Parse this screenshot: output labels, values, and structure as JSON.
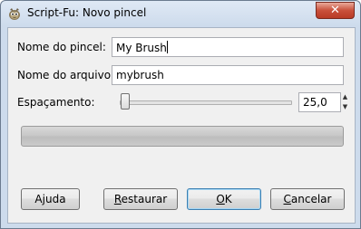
{
  "window": {
    "title": "Script-Fu: Novo pincel",
    "close_label": "✕"
  },
  "form": {
    "brush_name_label": "Nome do pincel:",
    "brush_name_value": "My Brush",
    "file_name_label": "Nome do arquivo:",
    "file_name_value": "mybrush",
    "spacing_label": "Espaçamento:",
    "spacing_value": "25,0",
    "spacing_slider_fraction": 0.0
  },
  "progress": {
    "fraction": 0.0
  },
  "buttons": {
    "help": {
      "first": "A",
      "mnemonic": "j",
      "rest": "uda"
    },
    "reset": {
      "mnemonic": "R",
      "rest": "estaurar"
    },
    "ok": {
      "mnemonic": "O",
      "rest": "K"
    },
    "cancel": {
      "mnemonic": "C",
      "rest": "ancelar"
    }
  },
  "icons": {
    "app": "gimp-icon",
    "close": "close-icon",
    "spin_up": "chevron-up-icon",
    "spin_down": "chevron-down-icon"
  }
}
